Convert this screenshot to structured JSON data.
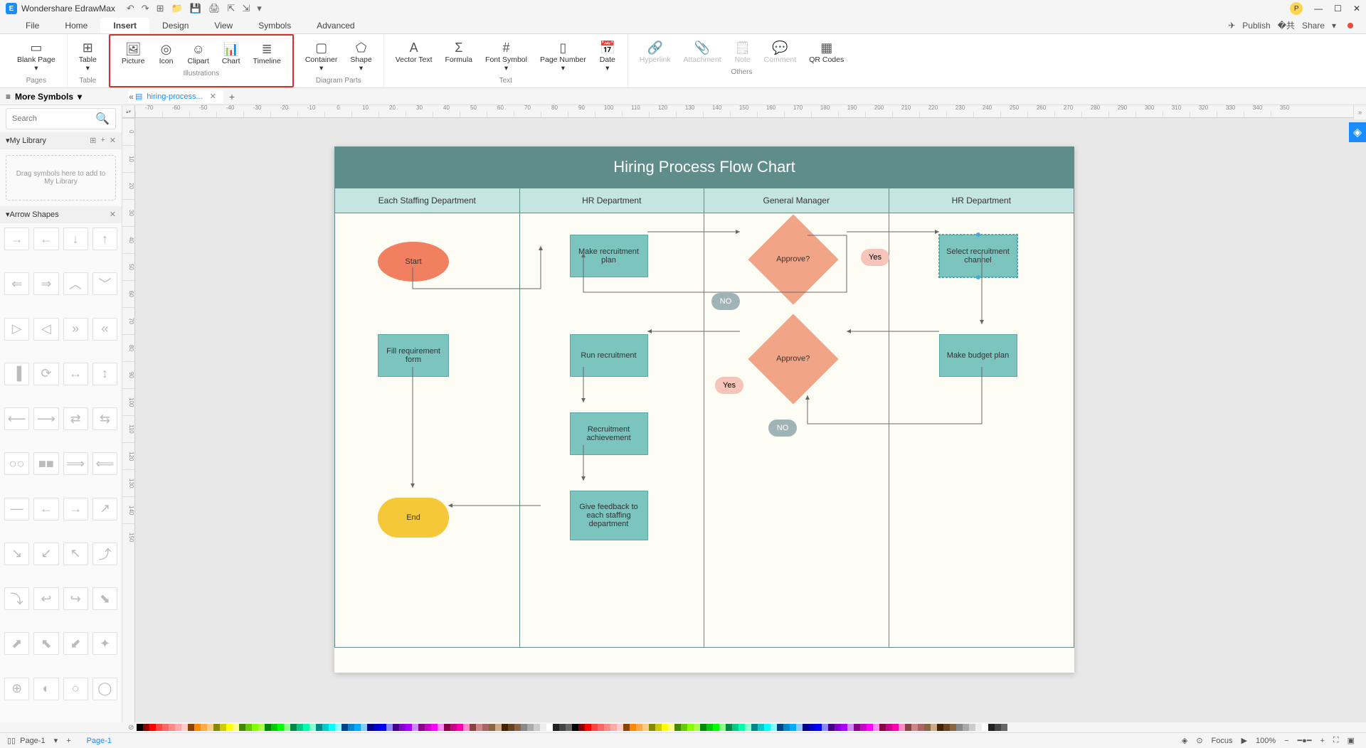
{
  "app": {
    "title": "Wondershare EdrawMax"
  },
  "menu": {
    "items": [
      "File",
      "Home",
      "Insert",
      "Design",
      "View",
      "Symbols",
      "Advanced"
    ],
    "active": "Insert",
    "publish": "Publish",
    "share": "Share"
  },
  "ribbon": {
    "pages": {
      "blank": "Blank Page",
      "label": "Pages"
    },
    "table": {
      "btn": "Table",
      "label": "Table"
    },
    "illus": {
      "picture": "Picture",
      "icon": "Icon",
      "clipart": "Clipart",
      "chart": "Chart",
      "timeline": "Timeline",
      "label": "Illustrations"
    },
    "diagram": {
      "container": "Container",
      "shape": "Shape",
      "label": "Diagram Parts"
    },
    "text": {
      "vector": "Vector Text",
      "formula": "Formula",
      "font": "Font Symbol",
      "page": "Page Number",
      "date": "Date",
      "label": "Text"
    },
    "others": {
      "hyperlink": "Hyperlink",
      "attachment": "Attachment",
      "note": "Note",
      "comment": "Comment",
      "qr": "QR Codes",
      "label": "Others"
    }
  },
  "tabs": {
    "doc": "hiring-process..."
  },
  "sidebar": {
    "title": "More Symbols",
    "search_placeholder": "Search",
    "mylib": "My Library",
    "drop": "Drag symbols here to add to My Library",
    "arrows": "Arrow Shapes"
  },
  "chart": {
    "title": "Hiring Process Flow Chart",
    "lanes": [
      "Each Staffing Department",
      "HR Department",
      "General Manager",
      "HR Department"
    ],
    "nodes": {
      "start": "Start",
      "fill": "Fill requirement form",
      "end": "End",
      "make": "Make recruitment plan",
      "run": "Run recruitment",
      "achieve": "Recruitment achievement",
      "feedback": "Give feedback to each staffing department",
      "approve1": "Approve?",
      "approve2": "Approve?",
      "yes": "Yes",
      "no1": "NO",
      "no2": "NO",
      "select": "Select recruitment channel",
      "budget": "Make budget plan"
    }
  },
  "status": {
    "page": "Page-1",
    "page2": "Page-1",
    "focus": "Focus",
    "zoom": "100%"
  },
  "ruler_h": [
    "-70",
    "-60",
    "-50",
    "-40",
    "-30",
    "-20",
    "-10",
    "0",
    "10",
    "20",
    "30",
    "40",
    "50",
    "60",
    "70",
    "80",
    "90",
    "100",
    "110",
    "120",
    "130",
    "140",
    "150",
    "160",
    "170",
    "180",
    "190",
    "200",
    "210",
    "220",
    "230",
    "240",
    "250",
    "260",
    "270",
    "280",
    "290",
    "300",
    "310",
    "320",
    "330",
    "340",
    "350"
  ],
  "ruler_v": [
    "0",
    "10",
    "20",
    "30",
    "40",
    "50",
    "60",
    "70",
    "80",
    "90",
    "100",
    "110",
    "120",
    "130",
    "140",
    "150"
  ],
  "colors": [
    "#000",
    "#800",
    "#f00",
    "#f44",
    "#f66",
    "#f88",
    "#faa",
    "#fcc",
    "#840",
    "#f80",
    "#fa4",
    "#fc8",
    "#880",
    "#cc0",
    "#ff0",
    "#ff8",
    "#480",
    "#6c0",
    "#8f0",
    "#af4",
    "#080",
    "#0c0",
    "#0f0",
    "#8f8",
    "#084",
    "#0c8",
    "#0fa",
    "#8fc",
    "#088",
    "#0cc",
    "#0ff",
    "#8ff",
    "#048",
    "#08c",
    "#0af",
    "#8cf",
    "#008",
    "#00c",
    "#00f",
    "#88f",
    "#408",
    "#80c",
    "#a0f",
    "#c8f",
    "#808",
    "#c0c",
    "#f0f",
    "#f8f",
    "#804",
    "#c08",
    "#f0a",
    "#f8c",
    "#844",
    "#c88",
    "#a66",
    "#864",
    "#ca8",
    "#420",
    "#642",
    "#864",
    "#888",
    "#aaa",
    "#ccc",
    "#eee",
    "#fff",
    "#222",
    "#444",
    "#666"
  ]
}
